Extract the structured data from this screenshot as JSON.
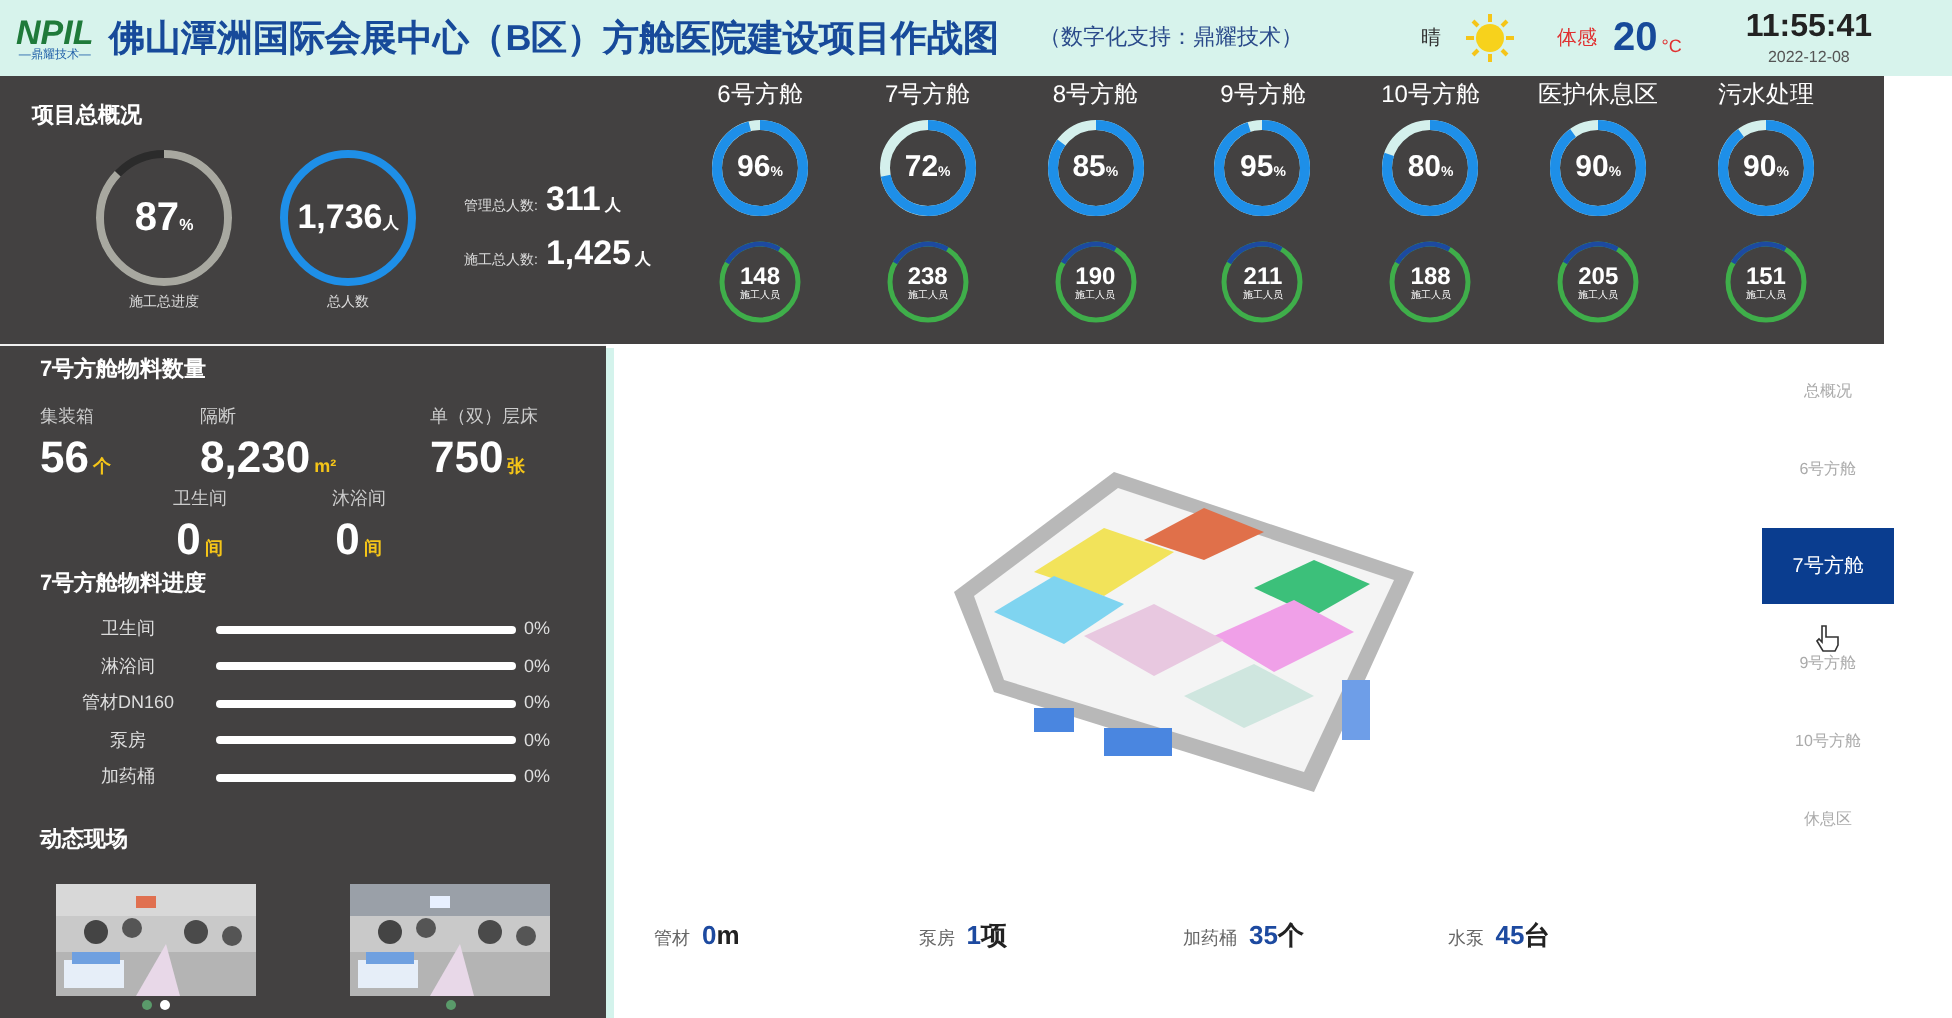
{
  "header": {
    "logo": {
      "mark": "NPIL",
      "tagline": "—鼎耀技术—"
    },
    "title": "佛山潭洲国际会展中心（B区）方舱医院建设项目作战图",
    "support": "（数字化支持：鼎耀技术）",
    "weather": {
      "condition": "晴",
      "feels_label": "体感",
      "temperature": "20",
      "unit": "°C"
    },
    "time": "11:55:41",
    "date": "2022-12-08"
  },
  "overview": {
    "title": "项目总概况",
    "progress": {
      "value": "87",
      "unit": "%",
      "label": "施工总进度",
      "level": 0.87
    },
    "total": {
      "value": "1,736",
      "unit": "人",
      "label": "总人数"
    },
    "stats": [
      {
        "label": "管理总人数:",
        "value": "311",
        "unit": "人"
      },
      {
        "label": "施工总人数:",
        "value": "1,425",
        "unit": "人"
      }
    ]
  },
  "pods": [
    {
      "name": "6号方舱",
      "percent": "96",
      "unit": "%",
      "level": 0.96,
      "workers": "148",
      "workers_label": "施工人员"
    },
    {
      "name": "7号方舱",
      "percent": "72",
      "unit": "%",
      "level": 0.72,
      "workers": "238",
      "workers_label": "施工人员"
    },
    {
      "name": "8号方舱",
      "percent": "85",
      "unit": "%",
      "level": 0.85,
      "workers": "190",
      "workers_label": "施工人员"
    },
    {
      "name": "9号方舱",
      "percent": "95",
      "unit": "%",
      "level": 0.95,
      "workers": "211",
      "workers_label": "施工人员"
    },
    {
      "name": "10号方舱",
      "percent": "80",
      "unit": "%",
      "level": 0.8,
      "workers": "188",
      "workers_label": "施工人员"
    },
    {
      "name": "医护休息区",
      "percent": "90",
      "unit": "%",
      "level": 0.9,
      "workers": "205",
      "workers_label": "施工人员"
    },
    {
      "name": "污水处理",
      "percent": "90",
      "unit": "%",
      "level": 0.9,
      "workers": "151",
      "workers_label": "施工人员"
    }
  ],
  "materials": {
    "title": "7号方舱物料数量",
    "items": [
      {
        "label": "集装箱",
        "value": "56",
        "unit": "个"
      },
      {
        "label": "隔断",
        "value": "8,230",
        "unit": "m²"
      },
      {
        "label": "单（双）层床",
        "value": "750",
        "unit": "张"
      },
      {
        "label": "卫生间",
        "value": "0",
        "unit": "间"
      },
      {
        "label": "沐浴间",
        "value": "0",
        "unit": "间"
      }
    ]
  },
  "progress": {
    "title": "7号方舱物料进度",
    "items": [
      {
        "label": "卫生间",
        "level": 0,
        "reading": "0%"
      },
      {
        "label": "淋浴间",
        "level": 0,
        "reading": "0%"
      },
      {
        "label": "管材DN160",
        "level": 0,
        "reading": "0%"
      },
      {
        "label": "泵房",
        "level": 0,
        "reading": "0%"
      },
      {
        "label": "加药桶",
        "level": 0,
        "reading": "0%"
      }
    ]
  },
  "live": {
    "title": "动态现场",
    "photos": [
      {
        "kind": "picture",
        "dots": [
          {
            "selected": false
          },
          {
            "selected": true
          }
        ]
      },
      {
        "kind": "picture",
        "dots": [
          {
            "selected": false
          }
        ]
      }
    ]
  },
  "nav": [
    {
      "label": "总概况",
      "selected": false
    },
    {
      "label": "6号方舱",
      "selected": false
    },
    {
      "label": "7号方舱",
      "selected": true
    },
    {
      "label": "9号方舱",
      "selected": false
    },
    {
      "label": "10号方舱",
      "selected": false
    },
    {
      "label": "休息区",
      "selected": false
    }
  ],
  "summary": [
    {
      "label": "管材",
      "value": "0",
      "unit": "m"
    },
    {
      "label": "泵房",
      "value": "1",
      "unit": "项"
    },
    {
      "label": "加药桶",
      "value": "35",
      "unit": "个"
    },
    {
      "label": "水泵",
      "value": "45",
      "unit": "台"
    }
  ]
}
